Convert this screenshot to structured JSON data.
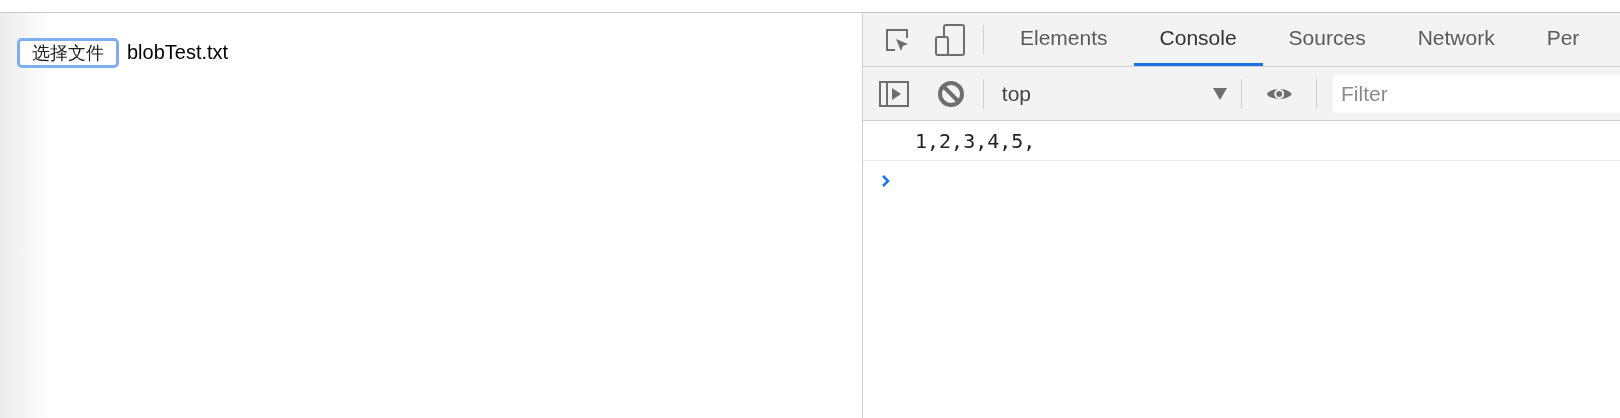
{
  "page": {
    "file_button": "选择文件",
    "file_name": "blobTest.txt"
  },
  "devtools": {
    "tabs": [
      {
        "label": "Elements",
        "selected": false
      },
      {
        "label": "Console",
        "selected": true
      },
      {
        "label": "Sources",
        "selected": false
      },
      {
        "label": "Network",
        "selected": false
      },
      {
        "label": "Per",
        "selected": false
      }
    ],
    "context": "top",
    "filter": {
      "placeholder": "Filter"
    },
    "messages": [
      "1,2,3,4,5,"
    ]
  }
}
